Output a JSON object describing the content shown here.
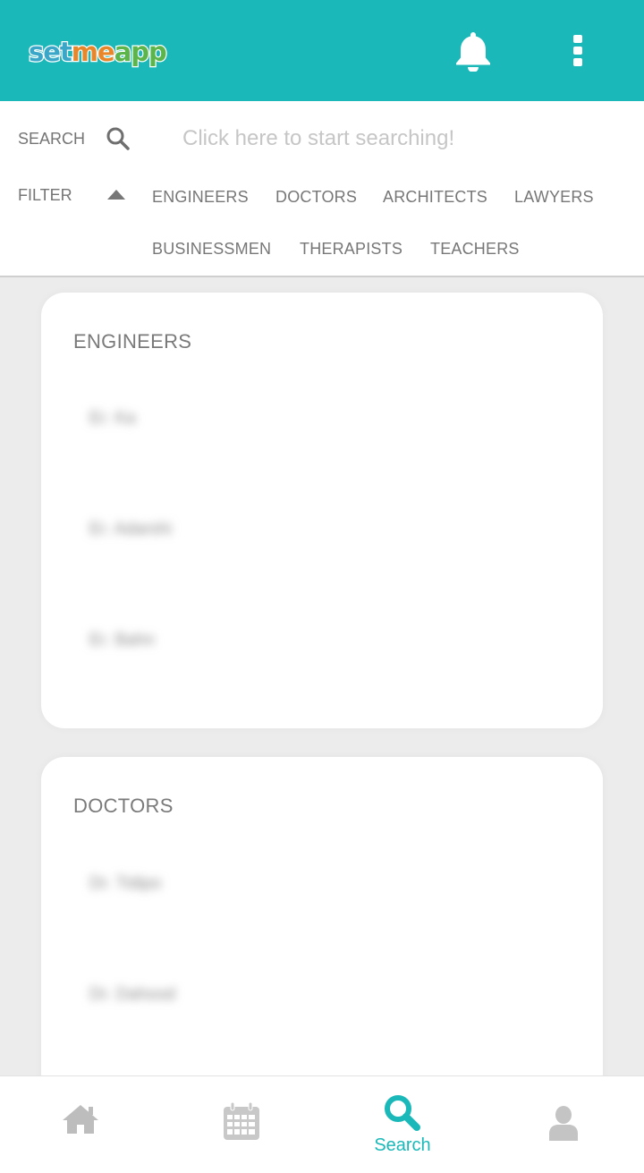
{
  "header": {
    "logo_part1": "set",
    "logo_part2": "me",
    "logo_part3": "app",
    "bell_icon": "bell-icon",
    "menu_icon": "more-vertical-icon",
    "background_color": "#1ab8b8"
  },
  "search": {
    "label": "SEARCH",
    "placeholder": "Click here to start searching!",
    "filter_label": "FILTER",
    "filters": [
      "ENGINEERS",
      "DOCTORS",
      "ARCHITECTS",
      "LAWYERS",
      "BUSINESSMEN",
      "THERAPISTS",
      "TEACHERS"
    ]
  },
  "sections": [
    {
      "title": "ENGINEERS",
      "items": [
        "Er. Ka",
        "Er. Adarshi",
        "Er. Bahn"
      ]
    },
    {
      "title": "DOCTORS",
      "items": [
        "Dr. Tidipo",
        "Dr. Dahood"
      ]
    }
  ],
  "bottom_nav": {
    "items": [
      {
        "icon": "home-icon",
        "label": ""
      },
      {
        "icon": "calendar-icon",
        "label": ""
      },
      {
        "icon": "search-icon",
        "label": "Search",
        "active": true
      },
      {
        "icon": "profile-icon",
        "label": ""
      }
    ],
    "active_color": "#1ab8b8",
    "inactive_color": "#bdbdbd"
  }
}
